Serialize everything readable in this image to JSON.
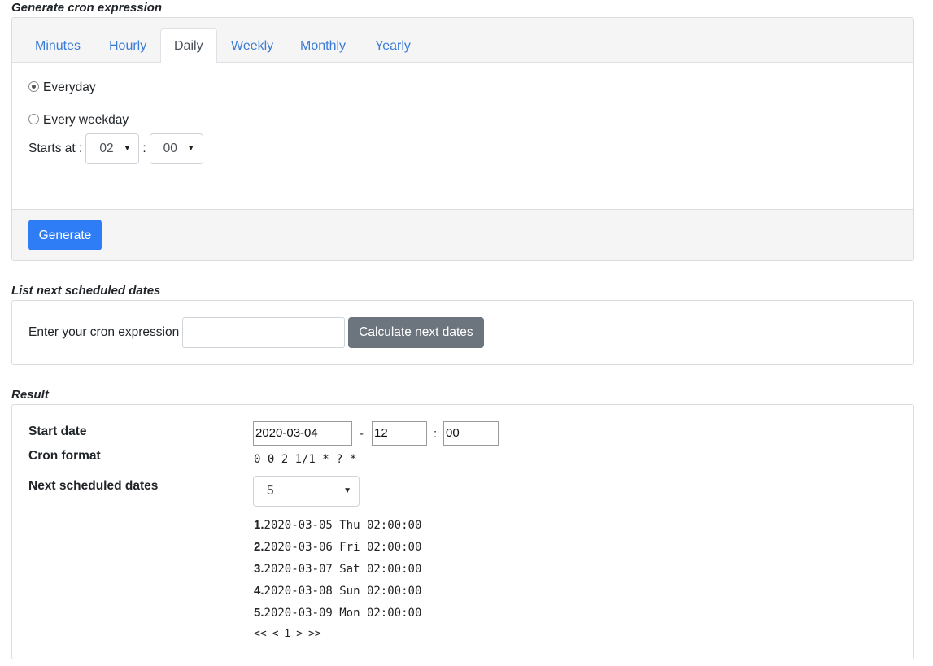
{
  "generate": {
    "title": "Generate cron expression",
    "tabs": [
      "Minutes",
      "Hourly",
      "Daily",
      "Weekly",
      "Monthly",
      "Yearly"
    ],
    "active_tab": "Daily",
    "options": {
      "everyday": "Everyday",
      "every_weekday": "Every weekday",
      "selected": "Everyday"
    },
    "starts_at_label": "Starts at :",
    "hour_value": "02",
    "colon": ":",
    "minute_value": "00",
    "generate_button": "Generate"
  },
  "list": {
    "title": "List next scheduled dates",
    "label": "Enter your cron expression",
    "input_value": "",
    "button": "Calculate next dates"
  },
  "result": {
    "title": "Result",
    "start_date_label": "Start date",
    "start_date": "2020-03-04",
    "dash": "-",
    "start_hour": "12",
    "colon": ":",
    "start_minute": "00",
    "cron_format_label": "Cron format",
    "cron_format": "0 0 2 1/1 * ? *",
    "next_label": "Next scheduled dates",
    "next_count": "5",
    "dates": [
      {
        "num": "1.",
        "value": "2020-03-05 Thu 02:00:00"
      },
      {
        "num": "2.",
        "value": "2020-03-06 Fri 02:00:00"
      },
      {
        "num": "3.",
        "value": "2020-03-07 Sat 02:00:00"
      },
      {
        "num": "4.",
        "value": "2020-03-08 Sun 02:00:00"
      },
      {
        "num": "5.",
        "value": "2020-03-09 Mon 02:00:00"
      }
    ],
    "pager": {
      "first": "<<",
      "prev": "<",
      "page": "1",
      "next": ">",
      "last": ">>"
    }
  },
  "colors": {
    "primary": "#2f7df6",
    "secondary": "#6c757d",
    "tab_link": "#3a7bd5"
  },
  "icons": {
    "select_caret": "caret-down-icon"
  }
}
